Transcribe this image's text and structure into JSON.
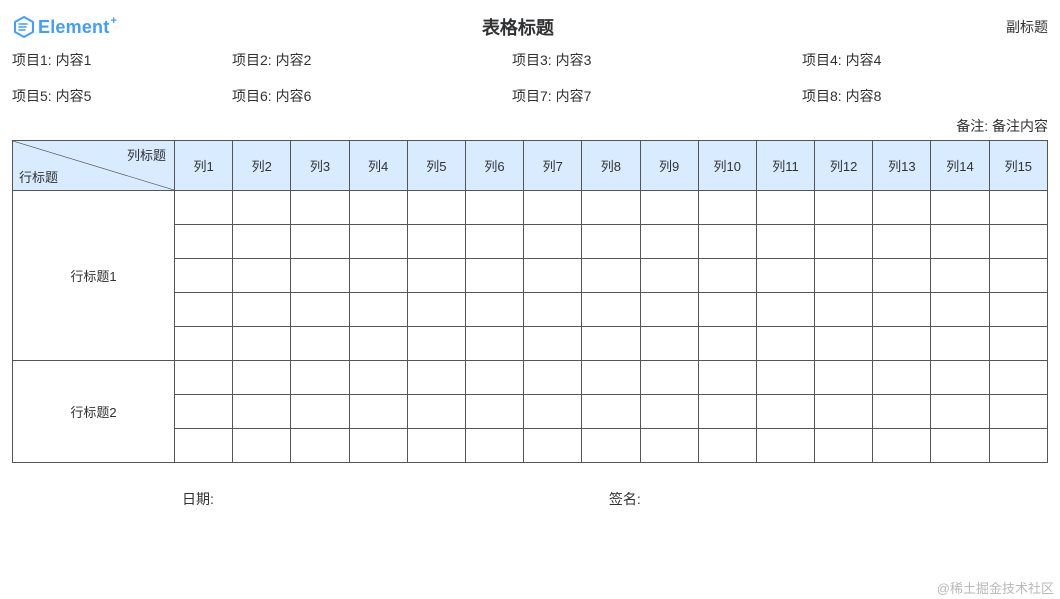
{
  "header": {
    "logo_text": "Element",
    "logo_plus": "+",
    "title": "表格标题",
    "subtitle": "副标题"
  },
  "items": [
    {
      "label": "项目1",
      "value": "内容1"
    },
    {
      "label": "项目2",
      "value": "内容2"
    },
    {
      "label": "项目3",
      "value": "内容3"
    },
    {
      "label": "项目4",
      "value": "内容4"
    },
    {
      "label": "项目5",
      "value": "内容5"
    },
    {
      "label": "项目6",
      "value": "内容6"
    },
    {
      "label": "项目7",
      "value": "内容7"
    },
    {
      "label": "项目8",
      "value": "内容8"
    }
  ],
  "remark": {
    "label": "备注",
    "value": "备注内容"
  },
  "table": {
    "corner": {
      "col_label": "列标题",
      "row_label": "行标题"
    },
    "columns": [
      "列1",
      "列2",
      "列3",
      "列4",
      "列5",
      "列6",
      "列7",
      "列8",
      "列9",
      "列10",
      "列11",
      "列12",
      "列13",
      "列14",
      "列15"
    ],
    "row_groups": [
      {
        "label": "行标题1",
        "rows": 5
      },
      {
        "label": "行标题2",
        "rows": 3
      }
    ]
  },
  "footer": {
    "date_label": "日期:",
    "sign_label": "签名:"
  },
  "watermark": "@稀土掘金技术社区"
}
